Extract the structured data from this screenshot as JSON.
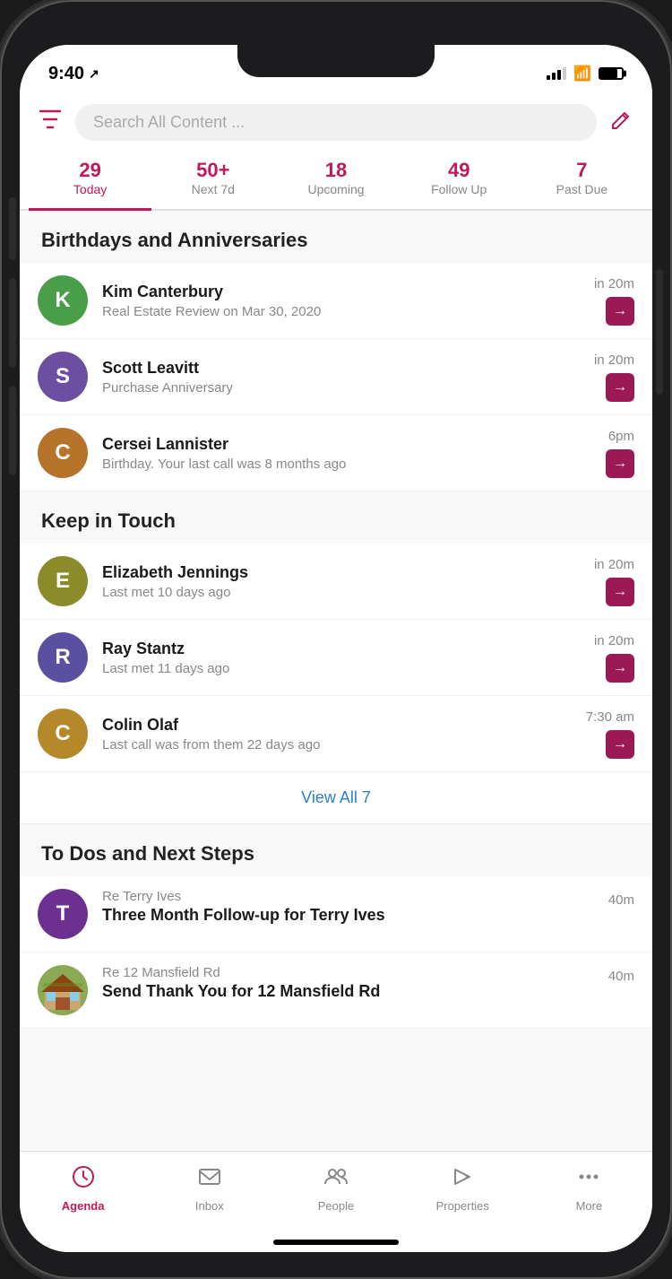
{
  "statusBar": {
    "time": "9:40",
    "locationArrow": "↗"
  },
  "searchBar": {
    "placeholder": "Search All Content ...",
    "filterLabel": "filter",
    "composeLabel": "compose"
  },
  "topTabs": [
    {
      "count": "29",
      "label": "Today",
      "active": true
    },
    {
      "count": "50+",
      "label": "Next 7d",
      "active": false
    },
    {
      "count": "18",
      "label": "Upcoming",
      "active": false
    },
    {
      "count": "49",
      "label": "Follow Up",
      "active": false
    },
    {
      "count": "7",
      "label": "Past Due",
      "active": false
    }
  ],
  "sections": {
    "birthdays": {
      "title": "Birthdays and Anniversaries",
      "items": [
        {
          "name": "Kim Canterbury",
          "sub": "Real Estate Review on Mar 30, 2020",
          "time": "in 20m",
          "avatarLetter": "K",
          "avatarColor": "av-green"
        },
        {
          "name": "Scott Leavitt",
          "sub": "Purchase Anniversary",
          "time": "in 20m",
          "avatarLetter": "S",
          "avatarColor": "av-purple"
        },
        {
          "name": "Cersei Lannister",
          "sub": "Birthday. Your last call was 8 months ago",
          "time": "6pm",
          "avatarLetter": "C",
          "avatarColor": "av-brown"
        }
      ]
    },
    "keepInTouch": {
      "title": "Keep in Touch",
      "items": [
        {
          "name": "Elizabeth Jennings",
          "sub": "Last met 10 days ago",
          "time": "in 20m",
          "avatarLetter": "E",
          "avatarColor": "av-olive"
        },
        {
          "name": "Ray Stantz",
          "sub": "Last met 11 days ago",
          "time": "in 20m",
          "avatarLetter": "R",
          "avatarColor": "av-blue-purple"
        },
        {
          "name": "Colin Olaf",
          "sub": "Last call was from them 22 days ago",
          "time": "7:30 am",
          "avatarLetter": "C",
          "avatarColor": "av-gold"
        }
      ],
      "viewAll": "View All 7"
    },
    "todos": {
      "title": "To Dos and Next Steps",
      "items": [
        {
          "reLabel": "Re",
          "reValue": "Terry Ives",
          "title": "Three Month Follow-up for Terry Ives",
          "time": "40m",
          "avatarLetter": "T",
          "avatarColor": "av-dark-purple",
          "isImage": false
        },
        {
          "reLabel": "Re",
          "reValue": "12 Mansfield Rd",
          "title": "Send Thank You for 12 Mansfield Rd",
          "time": "40m",
          "avatarLetter": "",
          "avatarColor": "",
          "isImage": true
        }
      ]
    }
  },
  "bottomTabs": [
    {
      "label": "Agenda",
      "icon": "clock",
      "active": true
    },
    {
      "label": "Inbox",
      "icon": "envelope",
      "active": false
    },
    {
      "label": "People",
      "icon": "people",
      "active": false
    },
    {
      "label": "Properties",
      "icon": "tag",
      "active": false
    },
    {
      "label": "More",
      "icon": "dots",
      "active": false
    }
  ]
}
